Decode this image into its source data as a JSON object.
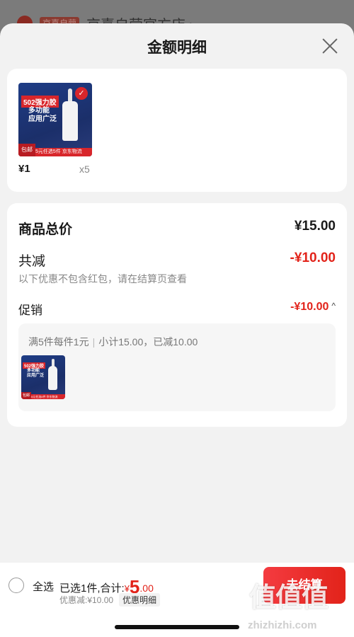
{
  "background": {
    "badge": "京喜自营",
    "store_name": "京喜自营官方店 ›"
  },
  "sheet": {
    "title": "金额明细"
  },
  "product": {
    "image": {
      "title": "502强力胶",
      "subtitle_1": "多功能",
      "subtitle_2": "应用广泛",
      "shipping_badge": "包邮",
      "footer": "5元任选5件 京东物流"
    },
    "price": "¥1",
    "quantity": "x5"
  },
  "summary": {
    "total_label": "商品总价",
    "total_value": "¥15.00",
    "reduce_label": "共减",
    "reduce_value": "-¥10.00",
    "note": "以下优惠不包含红包，请在结算页查看",
    "promo_label": "促销",
    "promo_value": "-¥10.00",
    "promo_rule": "满5件每件1元",
    "promo_subtotal": "小计15.00，已减10.00"
  },
  "bottom_bar": {
    "select_all": "全选",
    "selected_text": "已选1件,合计:",
    "currency": "¥",
    "total_int": "5",
    "total_dec": ".00",
    "discount_text": "优惠减:¥10.00",
    "detail_label": "优惠明细",
    "checkout_label": "去结算"
  },
  "watermark": {
    "logo": "值值值",
    "url": "zhizhizhi.com"
  },
  "colors": {
    "accent_red": "#e2231a",
    "product_blue": "#1f3d86"
  }
}
